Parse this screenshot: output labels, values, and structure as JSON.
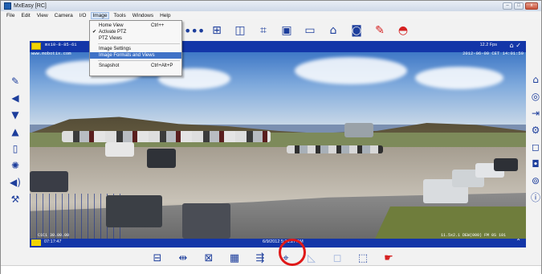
{
  "window": {
    "title": "MxEasy [RC]",
    "controls": [
      "–",
      "□",
      "x"
    ]
  },
  "menubar": {
    "items": [
      "File",
      "Edit",
      "View",
      "Camera",
      "I/O",
      "Image",
      "Tools",
      "Windows",
      "Help"
    ]
  },
  "dropdown": {
    "items": [
      {
        "label": "Home View",
        "shortcut": "Ctrl++"
      },
      {
        "label": "Activate PTZ",
        "checked": true
      },
      {
        "label": "PTZ Views"
      },
      {
        "label": "Image Settings"
      },
      {
        "label": "Image Formats and Views",
        "highlighted": true
      },
      {
        "label": "Snapshot",
        "shortcut": "Ctrl+Alt+P"
      }
    ],
    "check_mark": "✔"
  },
  "top_toolbar": {
    "icons": [
      "more-dots-icon",
      "layout-grid-icon",
      "split-view-icon",
      "crop-icon",
      "quad-view-icon",
      "record-icon",
      "door-icon",
      "alarm-icon",
      "wrench-icon",
      "siren-icon"
    ],
    "dots_text": "•••"
  },
  "camera": {
    "name": "mx10-8-85-61",
    "sub": "www.mobotix.com",
    "fps": "12.2 Fps",
    "timestamp_osd": "2012-06-09  CET  14:01:59",
    "footer_time": "07:17:47",
    "footer_date": "6/9/2012 5:31:27 AM",
    "osd_bottom_left": "C1C1  30.00.00",
    "osd_bottom_right": "11.5x2.1  DEW(000) FM 0S 101"
  },
  "left_toolbar": {
    "icons": [
      "pen-icon",
      "speaker-icon",
      "arrow-down-icon",
      "arrow-up-icon",
      "door-panel-icon",
      "light-icon",
      "volume-icon",
      "wrench-icon"
    ]
  },
  "right_toolbar": {
    "icons": [
      "home-icon",
      "lifebuoy-icon",
      "enter-icon",
      "gear-icon",
      "frame-icon",
      "camera-icon",
      "help-ring-icon",
      "info-icon"
    ]
  },
  "bottom_toolbar": {
    "icons": [
      "panorama-icon",
      "surround-icon",
      "double-panorama-icon",
      "full-image-icon",
      "split-arrow-icon",
      "ptz-crosshair-icon",
      "perspective-left-icon",
      "perspective-right-icon",
      "ptz-zoom-icon",
      "pointer-icon"
    ]
  },
  "colors": {
    "accent_blue": "#1336a8",
    "icon_blue": "#1d3e9c",
    "highlight_red": "#e01919",
    "menu_highlight": "#3f72c7",
    "badge_yellow": "#f2d300"
  }
}
